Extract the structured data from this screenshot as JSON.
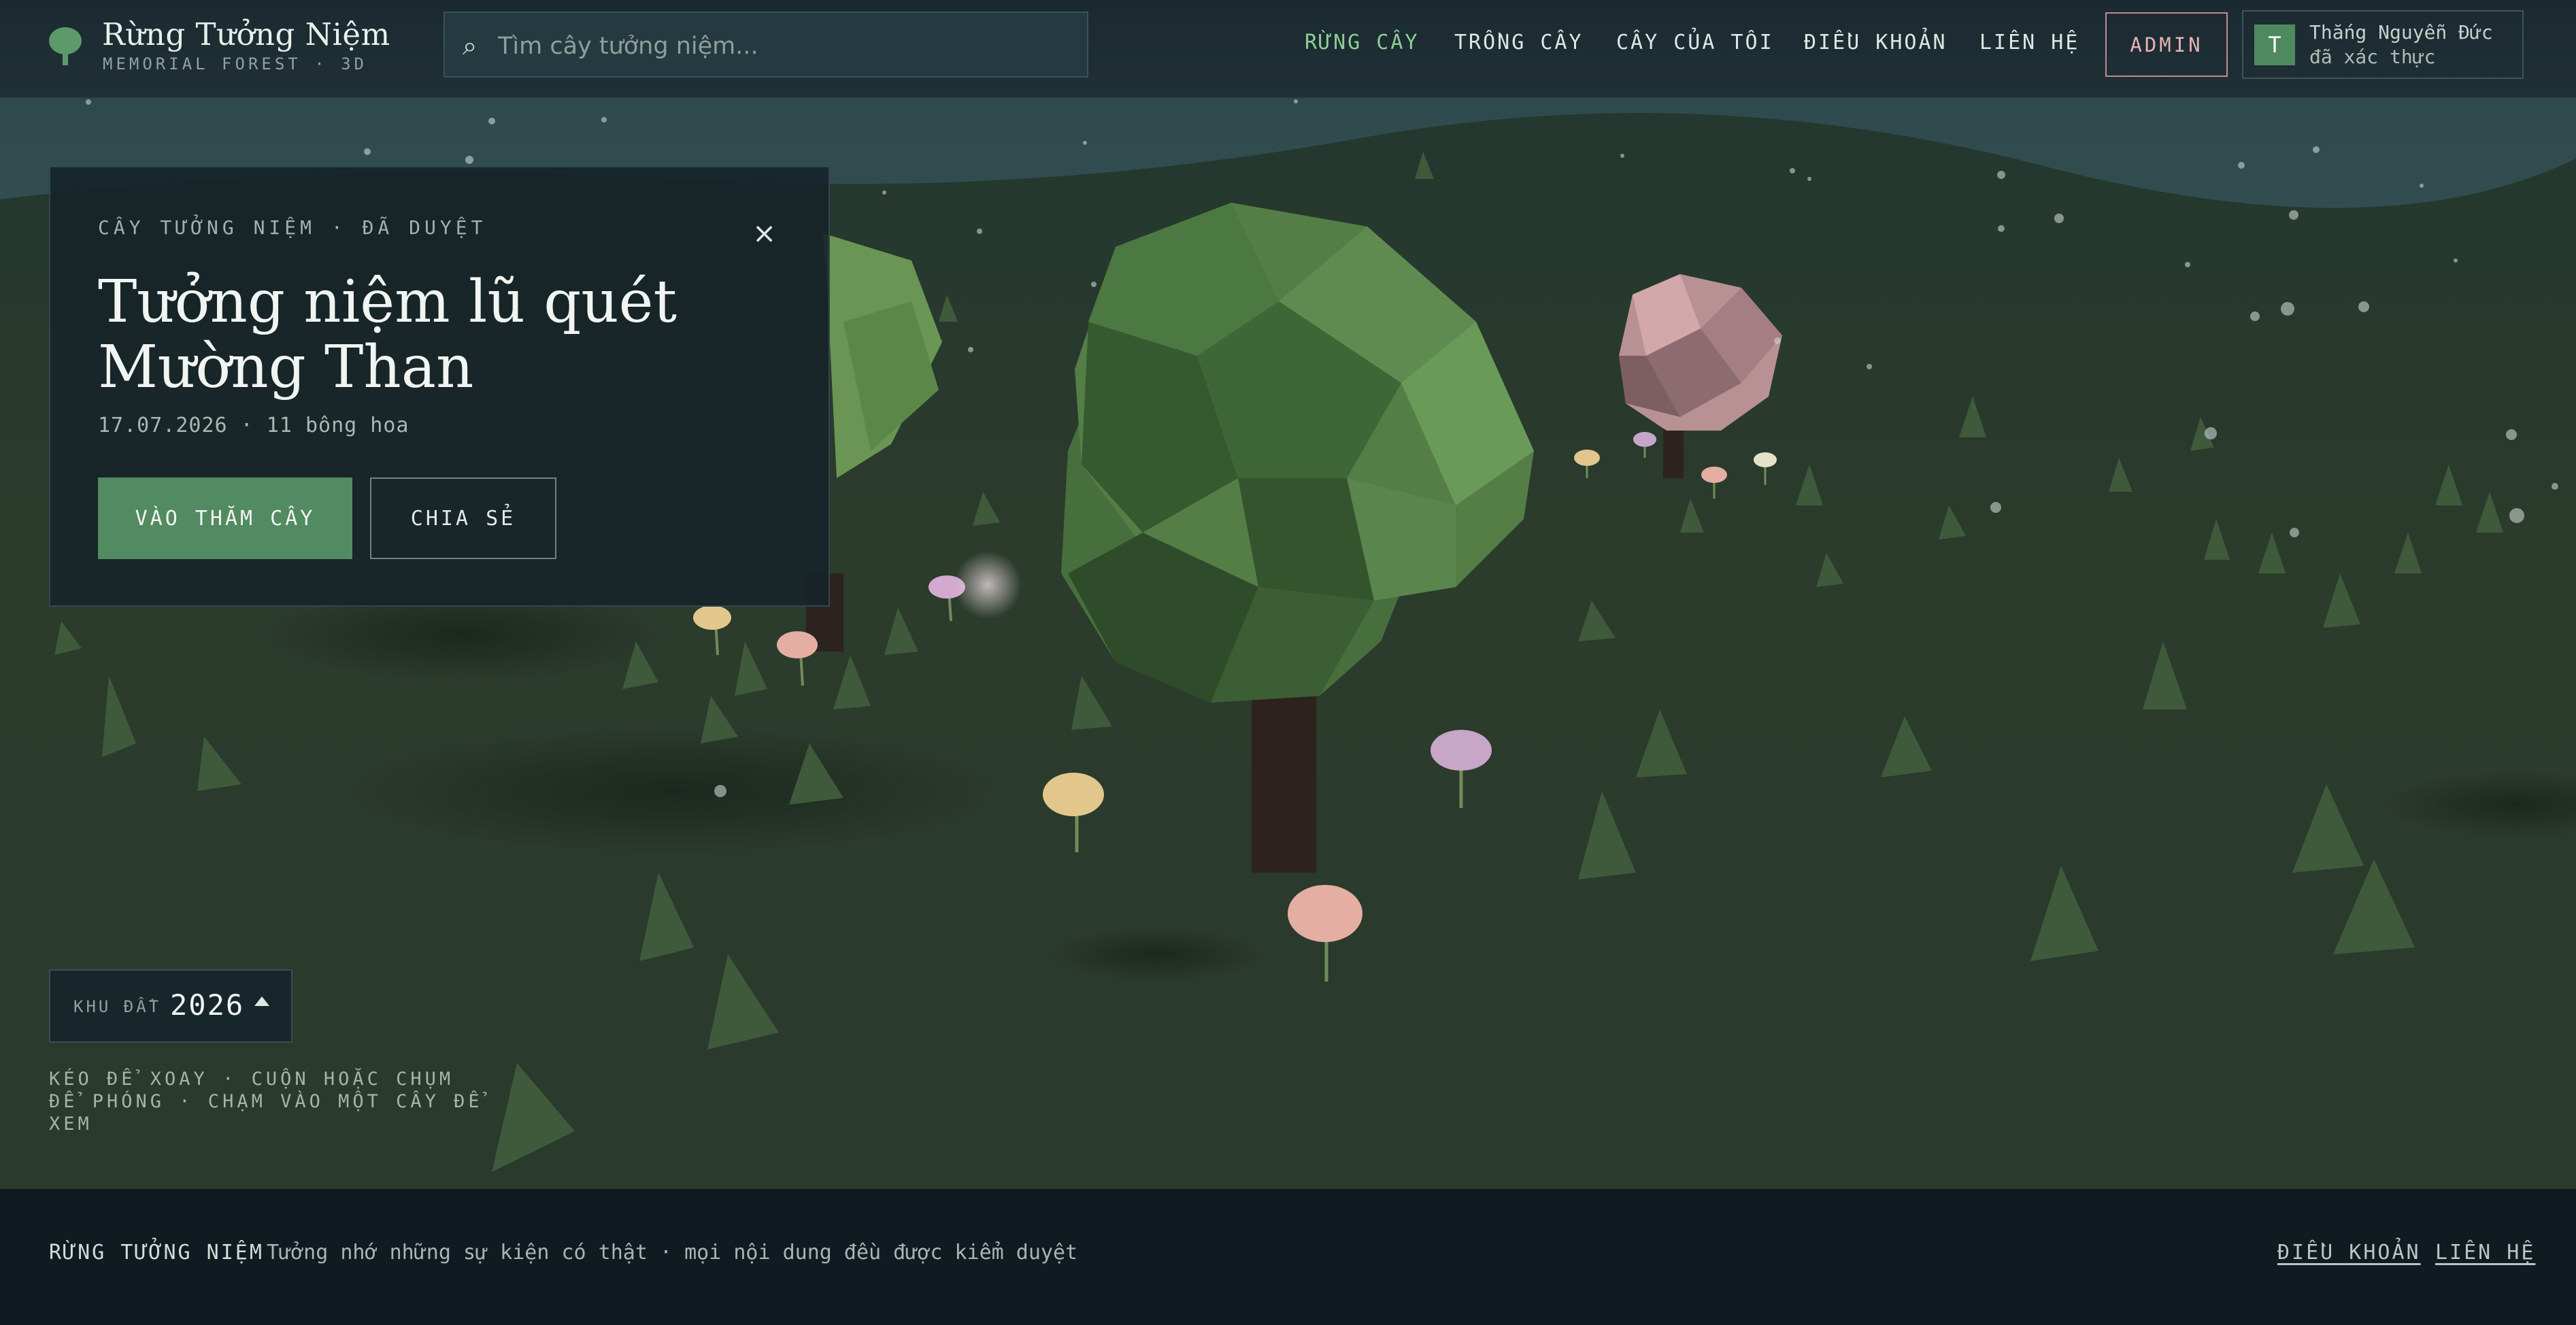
{
  "header": {
    "logo_title": "Rừng Tưởng Niệm",
    "logo_subtitle": "MEMORIAL FOREST · 3D",
    "search_placeholder": "Tìm cây tưởng niệm...",
    "nav": [
      "RỪNG CÂY",
      "TRỒNG CÂY",
      "CÂY CỦA TÔI",
      "ĐIỀU KHOẢN",
      "LIÊN HỆ"
    ],
    "active_nav": "RỪNG CÂY",
    "admin_label": "ADMIN",
    "user": {
      "initial": "T",
      "name": "Thắng Nguyễn Đức",
      "status": "đã xác thực"
    }
  },
  "panel": {
    "kicker": "CÂY TƯỞNG NIỆM · ĐÃ DUYỆT",
    "title_line1": "Tưởng niệm lũ quét",
    "title_line2": "Mường Than",
    "meta": "17.07.2026 · 11 bông hoa",
    "visit_label": "VÀO THĂM CÂY",
    "share_label": "CHIA SẺ",
    "close_glyph": "×"
  },
  "plot": {
    "label": "KHU ĐẤT",
    "year": "2026"
  },
  "hint": "KÉO ĐỂ XOAY · CUỘN HOẶC CHỤM ĐỂ PHÓNG · CHẠM VÀO MỘT CÂY ĐỂ XEM",
  "footer": {
    "brand": "RỪNG TƯỞNG NIỆM",
    "note": "Tưởng nhớ những sự kiện có thật · mọi nội dung đều được kiểm duyệt",
    "links": [
      "ĐIỀU KHOẢN",
      "LIÊN HỆ"
    ]
  },
  "colors": {
    "accent_green": "#528a62",
    "active_nav": "#8ccf95",
    "admin_pink": "#eab0b4",
    "ground": "#2c3a2c",
    "sky": "#3f6462"
  }
}
